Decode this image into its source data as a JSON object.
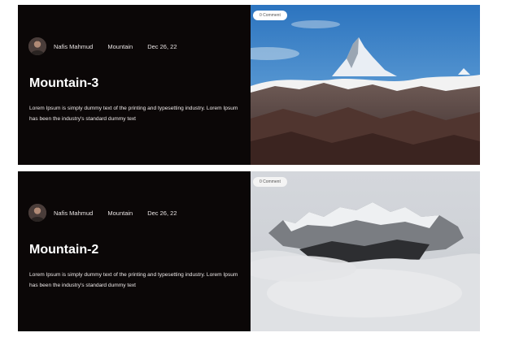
{
  "posts": [
    {
      "author": "Nafis Mahmud",
      "category": "Mountain",
      "date": "Dec 26, 22",
      "title": "Mountain-3",
      "excerpt": "Lorem Ipsum is simply dummy text of the printing and typesetting industry. Lorem Ipsum has been the industry's standard dummy text",
      "comments": "0 Comment"
    },
    {
      "author": "Nafis Mahmud",
      "category": "Mountain",
      "date": "Dec 26, 22",
      "title": "Mountain-2",
      "excerpt": "Lorem Ipsum is simply dummy text of the printing and typesetting industry. Lorem Ipsum has been the industry's standard dummy text",
      "comments": "0 Comment"
    }
  ],
  "colors": {
    "card_background": "#0b0707",
    "text_primary": "#ffffff",
    "sky_blue": "#2f7fc8"
  }
}
